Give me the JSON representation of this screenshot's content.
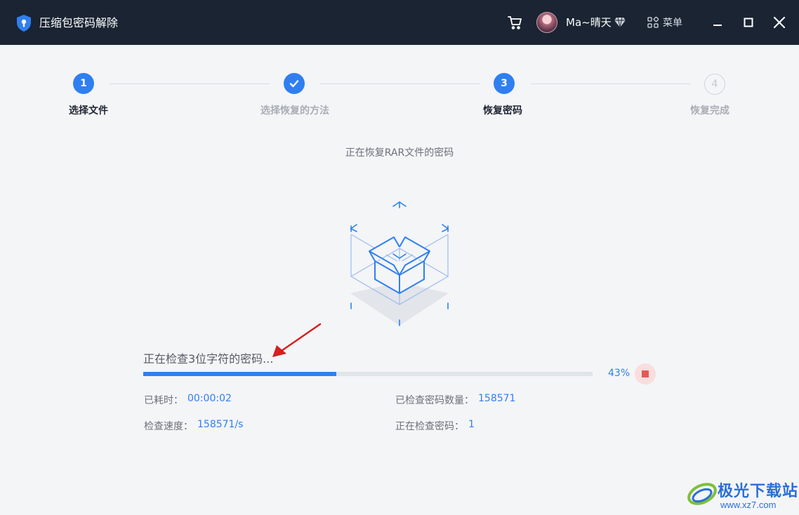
{
  "app": {
    "title": "压缩包密码解除",
    "username": "Ma~晴天",
    "menu_label": "菜单"
  },
  "steps": [
    {
      "number": "1",
      "label": "选择文件",
      "state": "active"
    },
    {
      "number": "",
      "label": "选择恢复的方法",
      "state": "done"
    },
    {
      "number": "3",
      "label": "恢复密码",
      "state": "active"
    },
    {
      "number": "4",
      "label": "恢复完成",
      "state": "pending"
    }
  ],
  "main": {
    "subtitle": "正在恢复RAR文件的密码",
    "status_text": "正在检查3位字符的密码...",
    "progress_percent_label": "43%",
    "progress_fraction": 0.43
  },
  "stats": {
    "elapsed_label": "已耗时：",
    "elapsed_value": "00:00:02",
    "checked_label": "已检查密码数量：",
    "checked_value": "158571",
    "speed_label": "检查速度：",
    "speed_value": "158571/s",
    "current_label": "正在检查密码：",
    "current_value": "1"
  },
  "watermark": {
    "title": "极光下载站",
    "url": "www.xz7.com"
  },
  "colors": {
    "titlebar_bg": "#1a2433",
    "accent": "#2f7ff0",
    "stop": "#e05a5a",
    "annotation_arrow": "#d42020"
  },
  "icons": {
    "logo": "shield-lock-icon",
    "cart": "cart-icon",
    "vip": "diamond-icon",
    "menu": "grid-icon",
    "minimize": "minimize-icon",
    "maximize": "maximize-icon",
    "close": "close-icon",
    "step_done": "checkmark-icon",
    "stop": "stop-icon"
  }
}
